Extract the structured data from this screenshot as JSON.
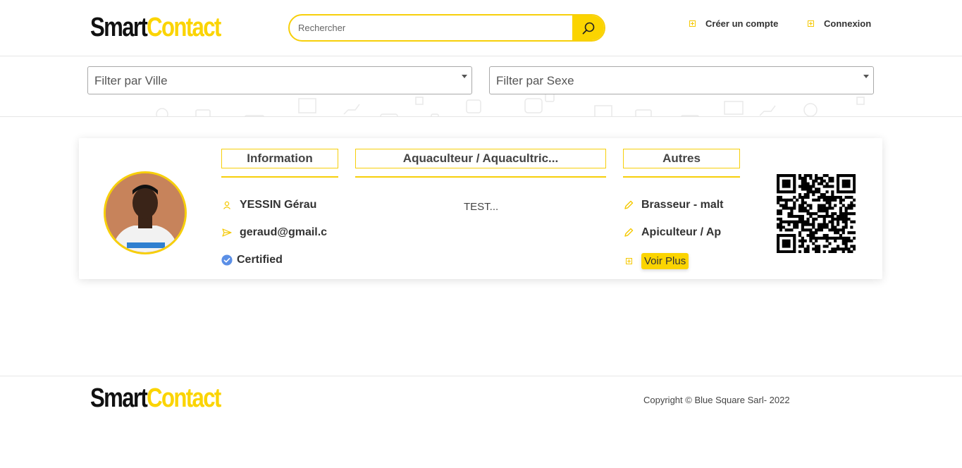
{
  "brand": {
    "part1": "Smart",
    "part2": "Contact"
  },
  "header": {
    "search_placeholder": "Rechercher",
    "create_account": "Créer un compte",
    "login": "Connexion"
  },
  "filters": {
    "city_placeholder": "Filter par Ville",
    "sex_placeholder": "Filter par Sexe"
  },
  "card": {
    "columns": [
      "Information",
      "Aquaculteur / Aquacultric...",
      "Autres"
    ],
    "info": {
      "name": "YESSIN Gérau",
      "email": "geraud@gmail.c",
      "certified": "Certified"
    },
    "description": "TEST...",
    "others": [
      "Brasseur - malt",
      "Apiculteur / Ap"
    ],
    "more_label": "Voir Plus"
  },
  "footer": {
    "copyright": "Copyright © Blue Square Sarl- 2022"
  },
  "colors": {
    "accent": "#fbd400",
    "text": "#333333",
    "verified": "#3b82f6"
  }
}
